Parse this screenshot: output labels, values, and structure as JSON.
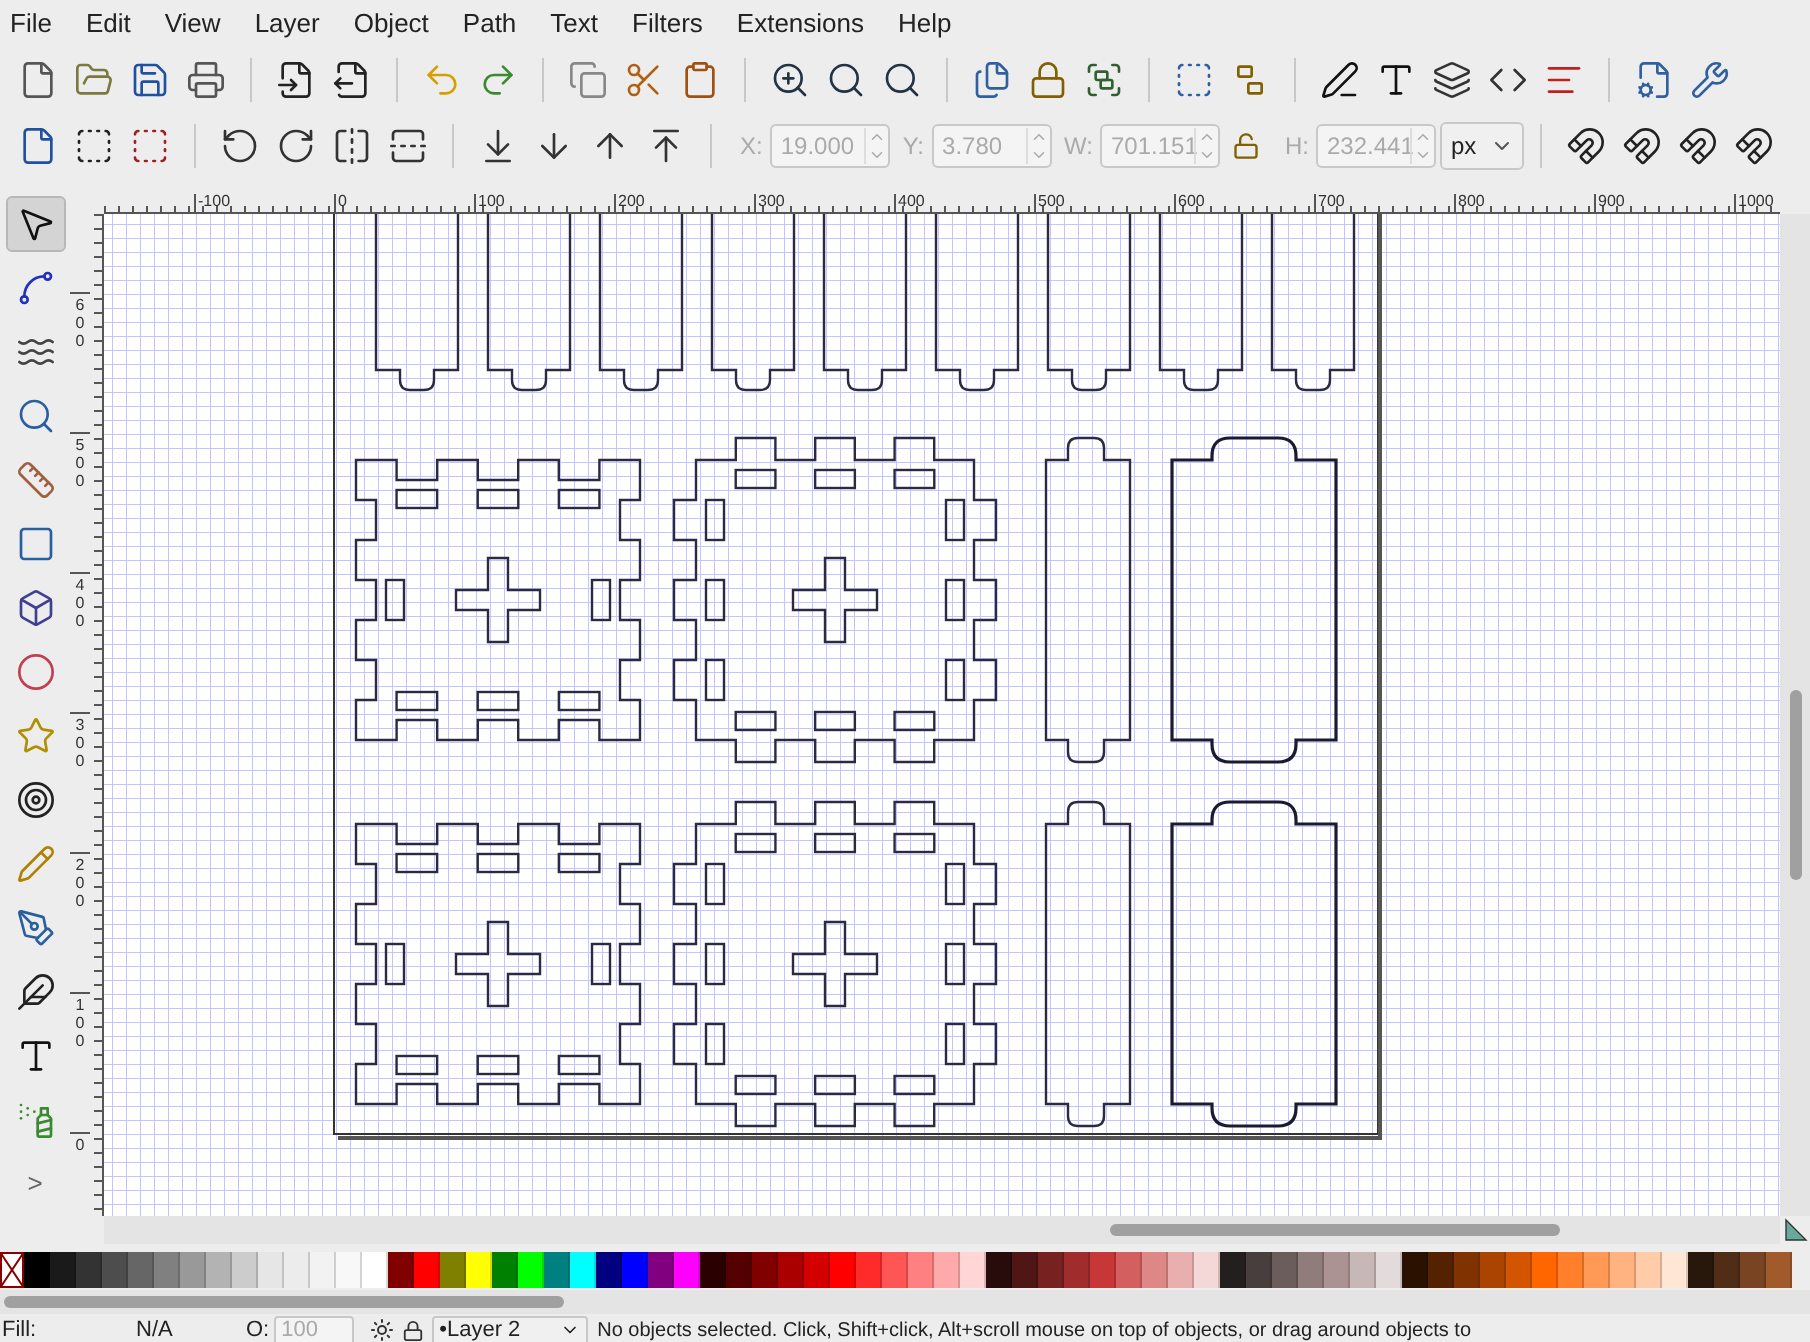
{
  "menu": [
    "File",
    "Edit",
    "View",
    "Layer",
    "Object",
    "Path",
    "Text",
    "Filters",
    "Extensions",
    "Help"
  ],
  "tools": [
    {
      "selected": true
    },
    {
      "selected": false
    },
    {
      "selected": false
    },
    {
      "selected": false
    },
    {
      "selected": false
    },
    {
      "selected": false
    },
    {
      "selected": false
    },
    {
      "selected": false
    },
    {
      "selected": false
    },
    {
      "selected": false
    },
    {
      "selected": false
    },
    {
      "selected": false
    },
    {
      "selected": false
    },
    {
      "selected": false
    },
    {
      "selected": false
    }
  ],
  "toolbox_more": ">",
  "transform_fields": [
    {
      "label": "X:",
      "value": "19.000",
      "disabled": true
    },
    {
      "label": "Y:",
      "value": "3.780",
      "disabled": true
    },
    {
      "label": "W:",
      "value": "701.151",
      "disabled": true
    },
    {
      "label": "H:",
      "value": "232.441",
      "disabled": true
    }
  ],
  "unit": "px",
  "rulers": {
    "horizontal": [
      "-100",
      "0",
      "100",
      "200",
      "300",
      "400",
      "500",
      "600",
      "700",
      "800",
      "900",
      "1000"
    ],
    "vertical": [
      "600",
      "500",
      "400",
      "300",
      "200",
      "100",
      "0"
    ]
  },
  "palette": [
    {
      "color": "#000000"
    },
    {
      "color": "#1a1a1a"
    },
    {
      "color": "#333333"
    },
    {
      "color": "#4d4d4d"
    },
    {
      "color": "#666666"
    },
    {
      "color": "#808080"
    },
    {
      "color": "#999999"
    },
    {
      "color": "#b3b3b3"
    },
    {
      "color": "#cccccc"
    },
    {
      "color": "#e6e6e6"
    },
    {
      "color": "#ececec"
    },
    {
      "color": "#f2f2f2"
    },
    {
      "color": "#f8f8f8"
    },
    {
      "color": "#ffffff"
    },
    {
      "color": "#800000"
    },
    {
      "color": "#ff0000"
    },
    {
      "color": "#808000"
    },
    {
      "color": "#ffff00"
    },
    {
      "color": "#008000"
    },
    {
      "color": "#00ff00"
    },
    {
      "color": "#008080"
    },
    {
      "color": "#00ffff"
    },
    {
      "color": "#000080"
    },
    {
      "color": "#0000ff"
    },
    {
      "color": "#800080"
    },
    {
      "color": "#ff00ff"
    },
    {
      "color": "#2b0000"
    },
    {
      "color": "#550000"
    },
    {
      "color": "#800000"
    },
    {
      "color": "#aa0000"
    },
    {
      "color": "#d40000"
    },
    {
      "color": "#ff0000"
    },
    {
      "color": "#ff2a2a"
    },
    {
      "color": "#ff5555"
    },
    {
      "color": "#ff8080"
    },
    {
      "color": "#ffaaaa"
    },
    {
      "color": "#ffd5d5"
    },
    {
      "color": "#280b0b"
    },
    {
      "color": "#501616"
    },
    {
      "color": "#782121"
    },
    {
      "color": "#a02c2c"
    },
    {
      "color": "#c83737"
    },
    {
      "color": "#d35f5f"
    },
    {
      "color": "#de8787"
    },
    {
      "color": "#e9afaf"
    },
    {
      "color": "#f4d7d7"
    },
    {
      "color": "#241f1f"
    },
    {
      "color": "#483e3e"
    },
    {
      "color": "#6c5d5d"
    },
    {
      "color": "#917c7c"
    },
    {
      "color": "#ac9393"
    },
    {
      "color": "#c8b7b7"
    },
    {
      "color": "#e3dbdb"
    },
    {
      "color": "#2b1100"
    },
    {
      "color": "#552200"
    },
    {
      "color": "#803300"
    },
    {
      "color": "#aa4400"
    },
    {
      "color": "#d45500"
    },
    {
      "color": "#ff6600"
    },
    {
      "color": "#ff7f2a"
    },
    {
      "color": "#ff9955"
    },
    {
      "color": "#ffb380"
    },
    {
      "color": "#ffccaa"
    },
    {
      "color": "#ffe6d5"
    },
    {
      "color": "#28170b"
    },
    {
      "color": "#502d16"
    },
    {
      "color": "#784421"
    },
    {
      "color": "#a05a2c"
    }
  ],
  "status_bar": {
    "fill_label": "Fill:",
    "fill_value": "N/A",
    "opacity_label": "O:",
    "opacity_value": "100",
    "opacity_disabled": true,
    "layer": "•Layer 2",
    "message": "No objects selected. Click, Shift+click, Alt+scroll mouse on top of objects, or drag around objects to"
  }
}
